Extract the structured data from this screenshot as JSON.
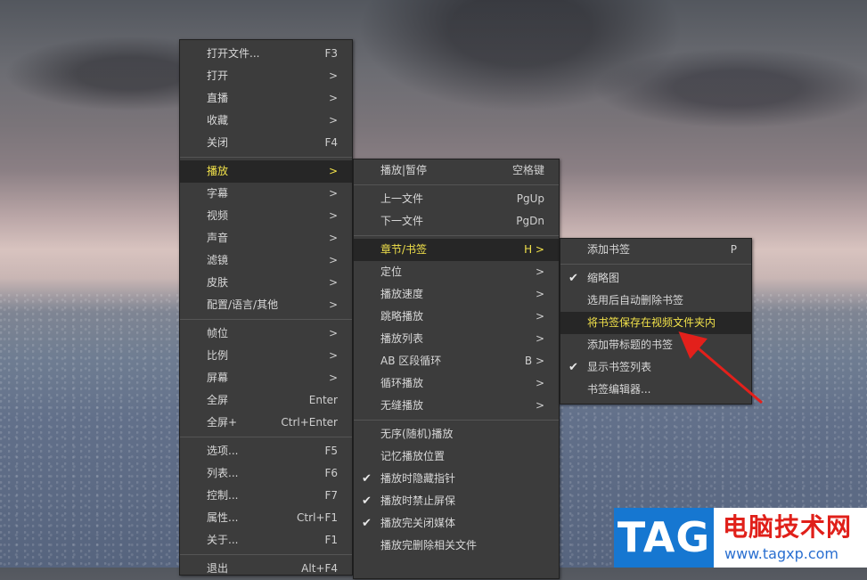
{
  "menus": {
    "main": [
      {
        "label": "打开文件...",
        "shortcut": "F3"
      },
      {
        "label": "打开",
        "shortcut": ">"
      },
      {
        "label": "直播",
        "shortcut": ">"
      },
      {
        "label": "收藏",
        "shortcut": ">"
      },
      {
        "label": "关闭",
        "shortcut": "F4"
      },
      {
        "label": "播放",
        "shortcut": ">"
      },
      {
        "label": "字幕",
        "shortcut": ">"
      },
      {
        "label": "视频",
        "shortcut": ">"
      },
      {
        "label": "声音",
        "shortcut": ">"
      },
      {
        "label": "滤镜",
        "shortcut": ">"
      },
      {
        "label": "皮肤",
        "shortcut": ">"
      },
      {
        "label": "配置/语言/其他",
        "shortcut": ">"
      },
      {
        "label": "帧位",
        "shortcut": ">"
      },
      {
        "label": "比例",
        "shortcut": ">"
      },
      {
        "label": "屏幕",
        "shortcut": ">"
      },
      {
        "label": "全屏",
        "shortcut": "Enter"
      },
      {
        "label": "全屏+",
        "shortcut": "Ctrl+Enter"
      },
      {
        "label": "选项...",
        "shortcut": "F5"
      },
      {
        "label": "列表...",
        "shortcut": "F6"
      },
      {
        "label": "控制...",
        "shortcut": "F7"
      },
      {
        "label": "属性...",
        "shortcut": "Ctrl+F1"
      },
      {
        "label": "关于...",
        "shortcut": "F1"
      },
      {
        "label": "退出",
        "shortcut": "Alt+F4"
      }
    ],
    "play": [
      {
        "label": "播放|暂停",
        "shortcut": "空格键"
      },
      {
        "label": "上一文件",
        "shortcut": "PgUp"
      },
      {
        "label": "下一文件",
        "shortcut": "PgDn"
      },
      {
        "label": "章节/书签",
        "shortcut": "H >"
      },
      {
        "label": "定位",
        "shortcut": ">"
      },
      {
        "label": "播放速度",
        "shortcut": ">"
      },
      {
        "label": "跳略播放",
        "shortcut": ">"
      },
      {
        "label": "播放列表",
        "shortcut": ">"
      },
      {
        "label": "AB 区段循环",
        "shortcut": "B >"
      },
      {
        "label": "循环播放",
        "shortcut": ">"
      },
      {
        "label": "无缝播放",
        "shortcut": ">"
      },
      {
        "label": "无序(随机)播放",
        "shortcut": ""
      },
      {
        "label": "记忆播放位置",
        "shortcut": ""
      },
      {
        "label": "播放时隐藏指针",
        "shortcut": ""
      },
      {
        "label": "播放时禁止屏保",
        "shortcut": ""
      },
      {
        "label": "播放完关闭媒体",
        "shortcut": ""
      },
      {
        "label": "播放完删除相关文件",
        "shortcut": ""
      }
    ],
    "chapter": [
      {
        "label": "添加书签",
        "shortcut": "P"
      },
      {
        "label": "缩略图",
        "shortcut": ""
      },
      {
        "label": "选用后自动删除书签",
        "shortcut": ""
      },
      {
        "label": "将书签保存在视频文件夹内",
        "shortcut": ""
      },
      {
        "label": "添加带标题的书签",
        "shortcut": ""
      },
      {
        "label": "显示书签列表",
        "shortcut": ""
      },
      {
        "label": "书签编辑器...",
        "shortcut": ""
      }
    ]
  },
  "icons": {
    "check": "check-icon"
  },
  "colors": {
    "highlight_text": "#f2e24a",
    "arrow": "#e3201b",
    "tag_blue": "#1677d1",
    "wm_red": "#e0201a"
  },
  "watermark": {
    "tag": "TAG",
    "title": "电脑技术网",
    "url": "www.tagxp.com"
  }
}
